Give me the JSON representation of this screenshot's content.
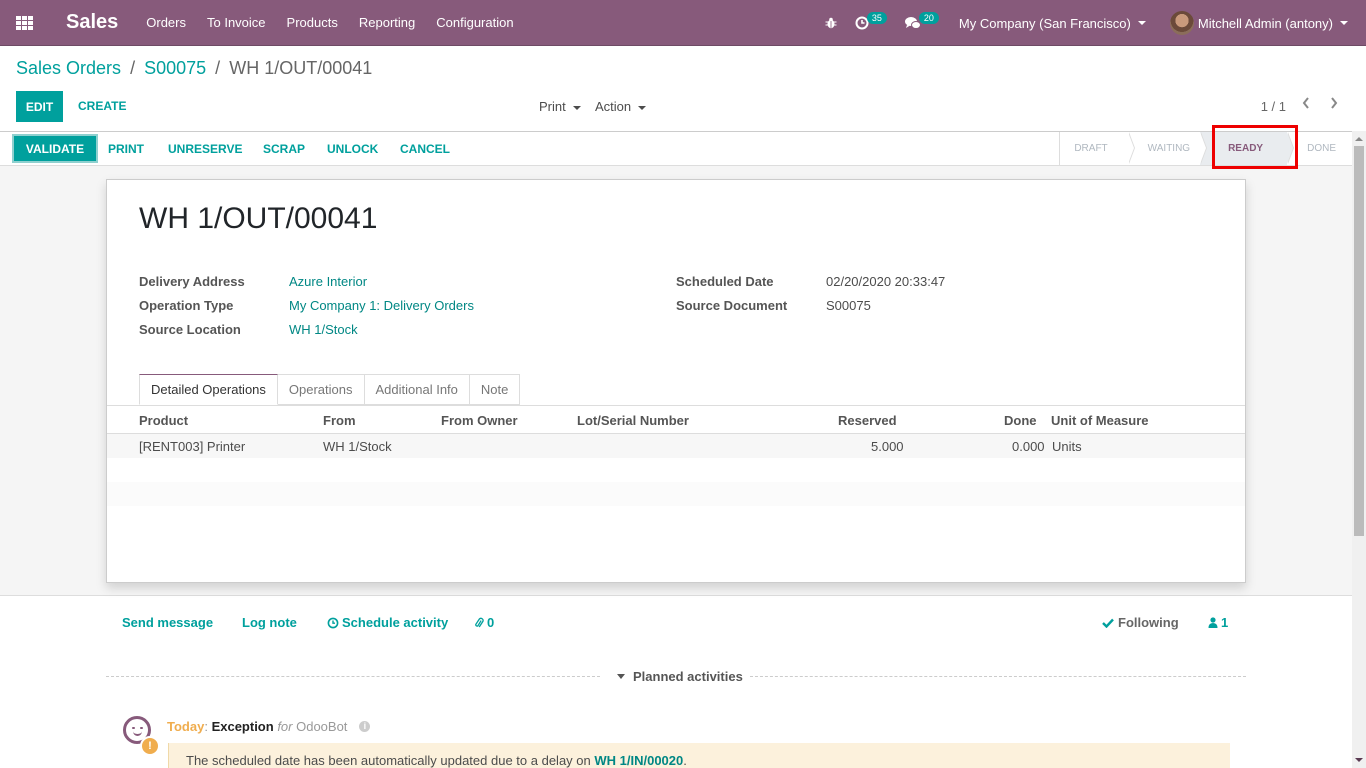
{
  "navbar": {
    "app_name": "Sales",
    "menu": [
      "Orders",
      "To Invoice",
      "Products",
      "Reporting",
      "Configuration"
    ],
    "activity_count": "35",
    "message_count": "20",
    "company": "My Company (San Francisco)",
    "user": "Mitchell Admin (antony)",
    "icons": {
      "apps": "apps-grid-icon",
      "debug": "bug-icon",
      "activity": "clock-icon",
      "messages": "chat-icon"
    },
    "color": "#875a7b"
  },
  "breadcrumb": {
    "items": [
      "Sales Orders",
      "S00075"
    ],
    "current": "WH 1/OUT/00041",
    "separator": "/"
  },
  "control_panel": {
    "edit_label": "EDIT",
    "create_label": "CREATE",
    "print_label": "Print",
    "action_label": "Action",
    "pager": "1 / 1"
  },
  "statusbar": {
    "buttons": {
      "validate": "VALIDATE",
      "print": "PRINT",
      "unreserve": "UNRESERVE",
      "scrap": "SCRAP",
      "unlock": "UNLOCK",
      "cancel": "CANCEL"
    },
    "stages": [
      "DRAFT",
      "WAITING",
      "READY",
      "DONE"
    ],
    "current_stage": "READY"
  },
  "record": {
    "title": "WH 1/OUT/00041",
    "fields_left": [
      {
        "label": "Delivery Address",
        "value": "Azure Interior"
      },
      {
        "label": "Operation Type",
        "value": "My Company 1: Delivery Orders"
      },
      {
        "label": "Source Location",
        "value": "WH 1/Stock"
      }
    ],
    "fields_right": [
      {
        "label": "Scheduled Date",
        "value": "02/20/2020 20:33:47"
      },
      {
        "label": "Source Document",
        "value": "S00075"
      }
    ],
    "tabs": [
      "Detailed Operations",
      "Operations",
      "Additional Info",
      "Note"
    ],
    "active_tab": "Detailed Operations",
    "table": {
      "columns": [
        "Product",
        "From",
        "From Owner",
        "Lot/Serial Number",
        "Reserved",
        "Done",
        "Unit of Measure"
      ],
      "rows": [
        {
          "product": "[RENT003] Printer",
          "from": "WH 1/Stock",
          "from_owner": "",
          "lot": "",
          "reserved": "5.000",
          "done": "0.000",
          "uom": "Units"
        }
      ]
    }
  },
  "chatter": {
    "send_message": "Send message",
    "log_note": "Log note",
    "schedule_activity": "Schedule activity",
    "attachments": "0",
    "following": "Following",
    "followers": "1",
    "planned_activities": "Planned activities",
    "activity": {
      "when": "Today",
      "type": "Exception",
      "for_label": "for",
      "user": "OdooBot",
      "note_prefix": "The scheduled date has been automatically updated due to a delay on ",
      "note_link": "WH 1/IN/00020",
      "note_suffix": "."
    }
  }
}
